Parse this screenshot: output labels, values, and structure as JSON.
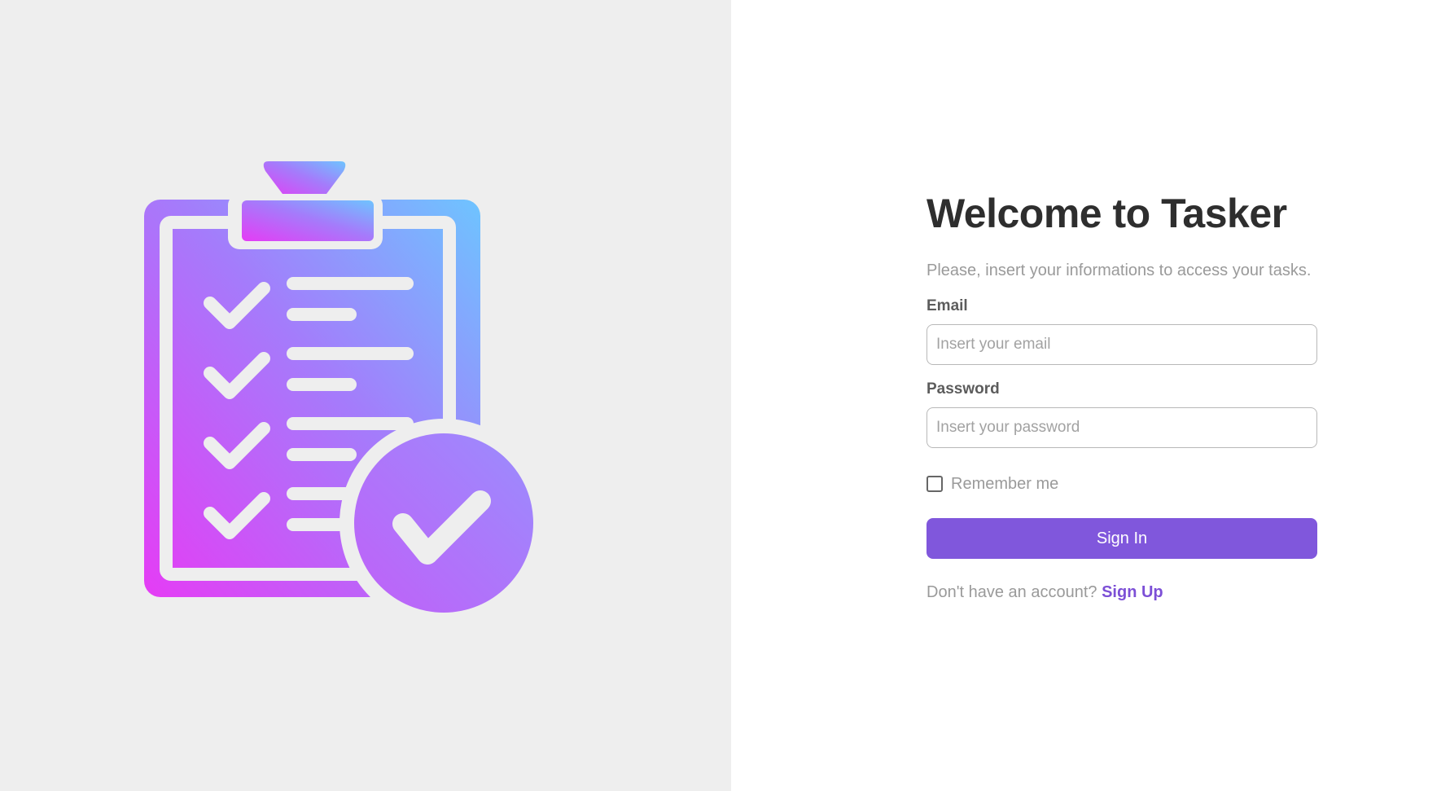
{
  "login": {
    "title": "Welcome to Tasker",
    "subtitle": "Please, insert your informations to access your tasks.",
    "email_label": "Email",
    "email_placeholder": "Insert your email",
    "password_label": "Password",
    "password_placeholder": "Insert your password",
    "remember_label": "Remember me",
    "remember_checked": false,
    "signin_label": "Sign In",
    "signup_prompt": "Don't have an account?",
    "signup_link": "Sign Up"
  },
  "illustration": {
    "icon": "clipboard-checklist-icon"
  },
  "colors": {
    "left_background": "#eeeeee",
    "accent": "#8057dc",
    "link": "#7c4fd6",
    "gradient_start": "#e53cf5",
    "gradient_end": "#6ec4ff"
  }
}
